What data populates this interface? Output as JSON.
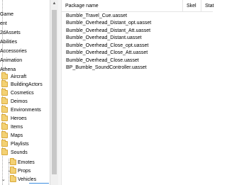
{
  "tree": {
    "items": [
      {
        "label": "Game",
        "level": 0
      },
      {
        "label": "ent",
        "level": 0
      },
      {
        "label": "2dAssets",
        "level": 0
      },
      {
        "label": "Abilities",
        "level": 0
      },
      {
        "label": "Accessories",
        "level": 0
      },
      {
        "label": "Animation",
        "level": 0
      },
      {
        "label": "Athena",
        "level": 0
      },
      {
        "label": "Aircraft",
        "level": 1
      },
      {
        "label": "BuildingActors",
        "level": 1
      },
      {
        "label": "Cosmetics",
        "level": 1
      },
      {
        "label": "Deimos",
        "level": 1
      },
      {
        "label": "Environments",
        "level": 1
      },
      {
        "label": "Heroes",
        "level": 1
      },
      {
        "label": "Items",
        "level": 1
      },
      {
        "label": "Maps",
        "level": 1
      },
      {
        "label": "Playlists",
        "level": 1
      },
      {
        "label": "Sounds",
        "level": 1
      },
      {
        "label": "Emotes",
        "level": 2
      },
      {
        "label": "Props",
        "level": 2
      },
      {
        "label": "Vehicles",
        "level": 2
      }
    ]
  },
  "list": {
    "columns": [
      "Package name",
      "Skel",
      "Stat"
    ],
    "rows": [
      "Bumble_Travel_Cue.uasset",
      "Bumble_Overhead_Distant_opt.uasset",
      "Bumble_Overhead_Distant_Att.uasset",
      "Bumble_Overhead_Distant.uasset",
      "Bumble_Overhead_Close_opt.uasset",
      "Bumble_Overhead_Close_Att.uasset",
      "Bumble_Overhead_Close.uasset",
      "BP_Bumble_SoundController.uasset"
    ]
  },
  "colors": {
    "folder": "#f3d174",
    "selection": "#3b8de0"
  }
}
